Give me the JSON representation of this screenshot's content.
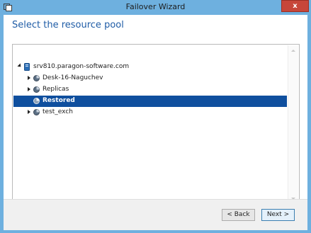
{
  "window": {
    "title": "Failover Wizard",
    "close_label": "x"
  },
  "page": {
    "heading": "Select the resource pool"
  },
  "tree": {
    "root": {
      "label": "srv810.paragon-software.com",
      "icon": "server-icon",
      "expanded": true
    },
    "children": [
      {
        "label": "Desk-16-Naguchev",
        "icon": "resource-pool-icon",
        "expanded": false,
        "selected": false
      },
      {
        "label": "Replicas",
        "icon": "resource-pool-icon",
        "expanded": false,
        "selected": false
      },
      {
        "label": "Restored",
        "icon": "resource-pool-icon",
        "expanded": null,
        "selected": true
      },
      {
        "label": "test_exch",
        "icon": "resource-pool-icon",
        "expanded": false,
        "selected": false
      }
    ]
  },
  "buttons": {
    "back": "< Back",
    "next": "Next >"
  },
  "colors": {
    "title_bar": "#6eb0df",
    "close_button": "#c7463a",
    "heading": "#1f5ca6",
    "selection": "#0f4f9e"
  }
}
